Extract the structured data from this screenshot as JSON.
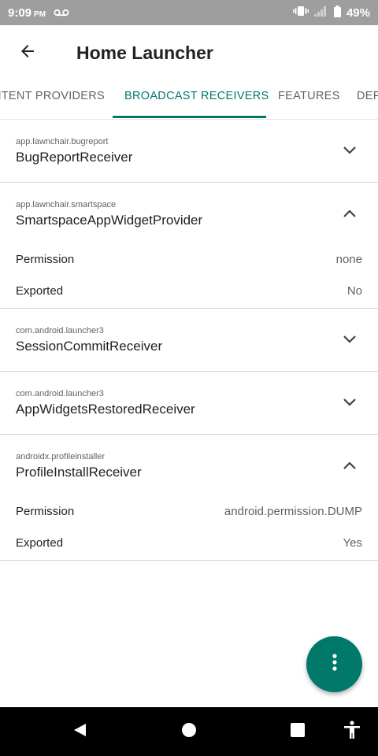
{
  "status_bar": {
    "time": "9:09",
    "ampm": "PM",
    "battery": "49%",
    "icons": [
      "voicemail-icon",
      "vibrate-icon",
      "signal-icon",
      "battery-icon"
    ]
  },
  "app_bar": {
    "title": "Home Launcher",
    "back_icon": "arrow-back-icon"
  },
  "tabs": [
    {
      "label": "NTENT PROVIDERS",
      "active": false
    },
    {
      "label": "BROADCAST RECEIVERS",
      "active": true
    },
    {
      "label": "FEATURES",
      "active": false
    },
    {
      "label": "DEF",
      "active": false
    }
  ],
  "receivers": [
    {
      "package": "app.lawnchair.bugreport",
      "name": "BugReportReceiver",
      "expanded": false
    },
    {
      "package": "app.lawnchair.smartspace",
      "name": "SmartspaceAppWidgetProvider",
      "expanded": true,
      "details": [
        {
          "key": "Permission",
          "value": "none"
        },
        {
          "key": "Exported",
          "value": "No"
        }
      ]
    },
    {
      "package": "com.android.launcher3",
      "name": "SessionCommitReceiver",
      "expanded": false
    },
    {
      "package": "com.android.launcher3",
      "name": "AppWidgetsRestoredReceiver",
      "expanded": false
    },
    {
      "package": "androidx.profileinstaller",
      "name": "ProfileInstallReceiver",
      "expanded": true,
      "details": [
        {
          "key": "Permission",
          "value": "android.permission.DUMP"
        },
        {
          "key": "Exported",
          "value": "Yes"
        }
      ]
    }
  ],
  "fab": {
    "icon": "more-vert-icon"
  },
  "nav_bar": {
    "icons": [
      "back-triangle-icon",
      "home-circle-icon",
      "recents-square-icon",
      "accessibility-icon"
    ]
  },
  "colors": {
    "accent": "#00796b",
    "status_bar": "#9e9e9e",
    "nav_bar": "#000000"
  }
}
